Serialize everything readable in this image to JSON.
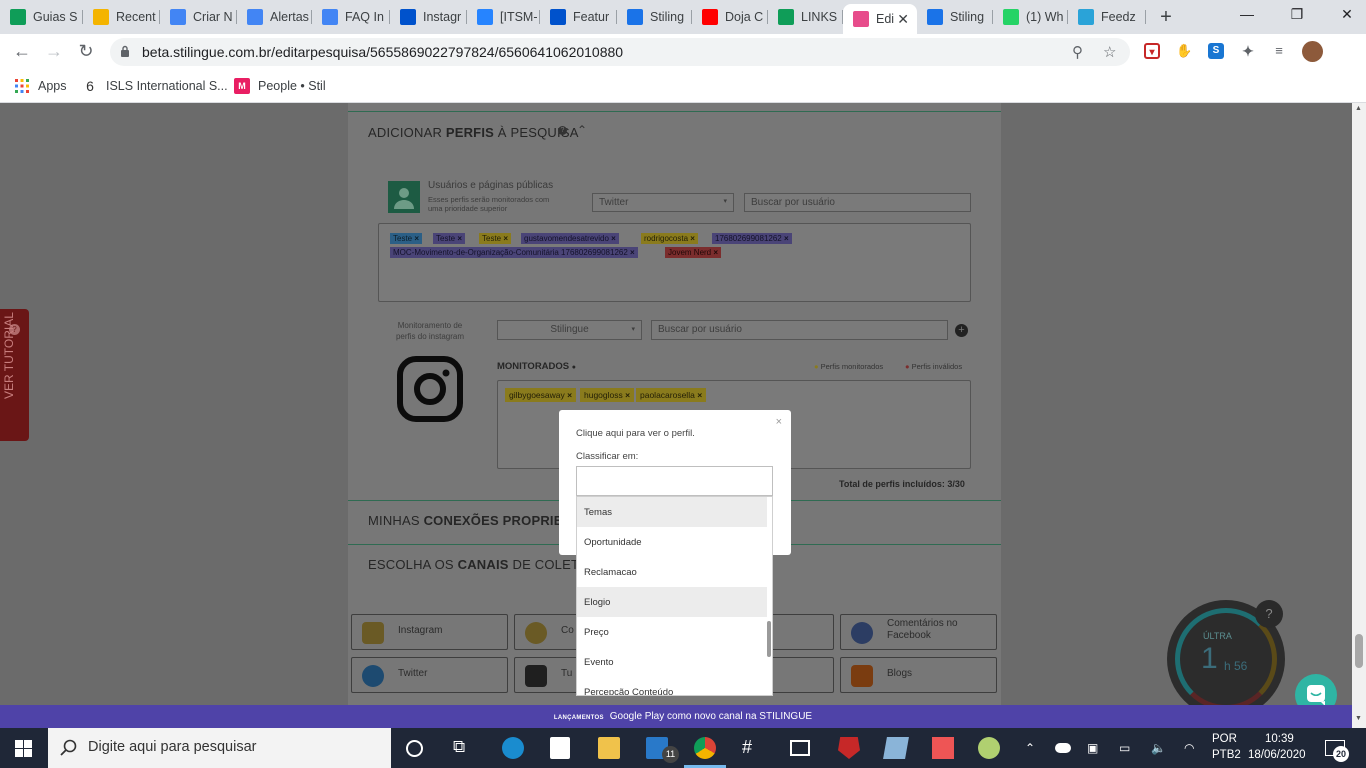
{
  "browser": {
    "tabs": [
      {
        "label": "Guias S",
        "fav": "sheets-icon",
        "color": "#0f9d58"
      },
      {
        "label": "Recent",
        "fav": "drive-icon",
        "color": "#f4b400"
      },
      {
        "label": "Criar N",
        "fav": "docs-icon",
        "color": "#4285f4"
      },
      {
        "label": "Alertas",
        "fav": "docs-icon",
        "color": "#4285f4"
      },
      {
        "label": "FAQ In",
        "fav": "docs-icon",
        "color": "#4285f4"
      },
      {
        "label": "Instagr",
        "fav": "confluence-icon",
        "color": "#0052cc"
      },
      {
        "label": "[ITSM-",
        "fav": "jira-icon",
        "color": "#2684ff"
      },
      {
        "label": "Featur",
        "fav": "confluence-icon",
        "color": "#0052cc"
      },
      {
        "label": "Stiling",
        "fav": "calendar-icon",
        "color": "#1a73e8"
      },
      {
        "label": "Doja C",
        "fav": "youtube-icon",
        "color": "#ff0000"
      },
      {
        "label": "LINKS",
        "fav": "sheets-icon",
        "color": "#0f9d58"
      },
      {
        "label": "Edi",
        "fav": "stilingue-icon",
        "color": "#e74c8b",
        "active": true
      },
      {
        "label": "Stiling",
        "fav": "calendar-icon",
        "color": "#1a73e8"
      },
      {
        "label": "(1) Wh",
        "fav": "whatsapp-icon",
        "color": "#25d366"
      },
      {
        "label": "Feedz",
        "fav": "feedz-icon",
        "color": "#2aa3d8"
      }
    ],
    "url": "beta.stilingue.com.br/editarpesquisa/5655869022797824/6560641062010880",
    "bookmarks": [
      {
        "label": "Apps"
      },
      {
        "label": "ISLS International S..."
      },
      {
        "label": "People • Stil"
      }
    ]
  },
  "page": {
    "add_profiles_prefix": "ADICIONAR ",
    "add_profiles_bold": "PERFIS",
    "add_profiles_suffix": " À PESQUISA",
    "users_pages_title": "Usuários e páginas públicas",
    "users_pages_desc_1": "Esses perfis serão monitorados com",
    "users_pages_desc_2": "uma prioridade superior",
    "network_select": "Twitter",
    "search_user_placeholder": "Buscar por usuário",
    "twitter_tags": [
      {
        "label": "Teste",
        "color": "blue"
      },
      {
        "label": "Teste",
        "color": "purple"
      },
      {
        "label": "Teste",
        "color": "yellow"
      },
      {
        "label": "gustavomendesatrevido",
        "color": "purple"
      },
      {
        "label": "rodrigocosta",
        "color": "yellow"
      },
      {
        "label": "176802699081262",
        "color": "purple"
      },
      {
        "label": "MOC-Movimento-de-Organização-Comunitária 176802699081262",
        "color": "purple"
      },
      {
        "label": "Jovem Nerd",
        "color": "red"
      }
    ],
    "instagram_monitor_label_1": "Monitoramento de",
    "instagram_monitor_label_2": "perfis do instagram",
    "account_select": "Stilingue",
    "monitored_title": "MONITORADOS",
    "legend_monitored": "Perfis monitorados",
    "legend_invalid": "Perfis inválidos",
    "instagram_tags": [
      "gilbygoesaway",
      "hugogloss",
      "paolacarosella"
    ],
    "total_profiles": "Total de perfis incluídos: 3/30",
    "connections_prefix": "MINHAS ",
    "connections_bold": "CONEXÕES PROPRIETÁ",
    "channels_prefix": "ESCOLHA OS ",
    "channels_bold": "CANAIS",
    "channels_suffix": " DE COLETA PA",
    "channels": [
      {
        "label": "Instagram",
        "icon": "instagram-icon"
      },
      {
        "label": "Co Ins",
        "icon": "instagram-comments-icon"
      },
      {
        "label": "",
        "icon": ""
      },
      {
        "label": "Comentários no Facebook",
        "icon": "facebook-comments-icon"
      },
      {
        "label": "Twitter",
        "icon": "twitter-icon"
      },
      {
        "label": "Tu",
        "icon": "tumblr-icon"
      },
      {
        "label": "",
        "icon": ""
      },
      {
        "label": "Blogs",
        "icon": "blogger-icon"
      }
    ],
    "tutorial_label": "VER TUTORIAL"
  },
  "modal": {
    "view_profile": "Clique aqui para ver o perfil.",
    "classify_label": "Classificar em:",
    "close": "×",
    "options": [
      "Temas",
      "Oportunidade",
      "Reclamacao",
      "Elogio",
      "Preço",
      "Evento",
      "Percepção Conteúdo"
    ]
  },
  "banner": {
    "tag": "LANÇAMENTOS",
    "text": "Google Play como novo canal na STILINGUE"
  },
  "widget": {
    "label": "ÚLTRA",
    "hours": "1",
    "minutes": "h 56"
  },
  "taskbar": {
    "search_placeholder": "Digite aqui para pesquisar",
    "lang_1": "POR",
    "lang_2": "PTB2",
    "time": "10:39",
    "date": "18/06/2020",
    "notif_count": "20",
    "mail_badge": "11"
  }
}
